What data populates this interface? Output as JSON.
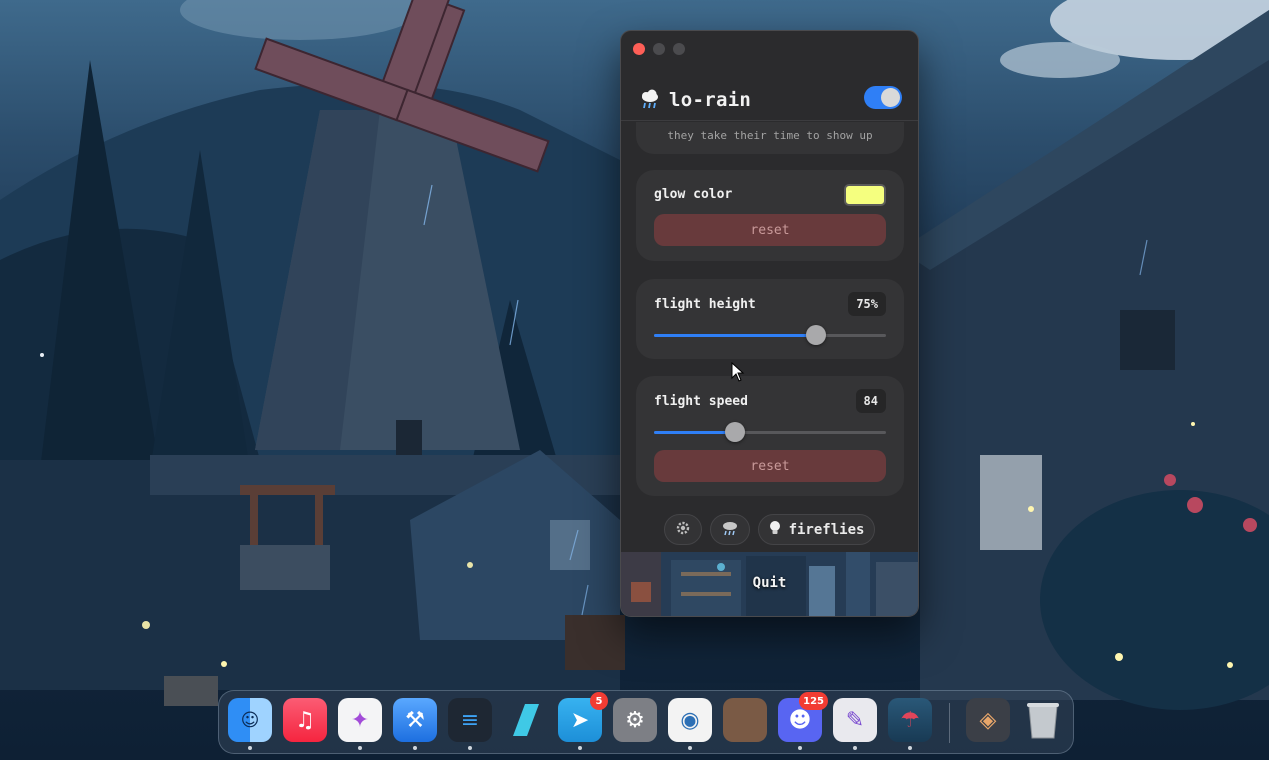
{
  "app": {
    "title": "lo-rain",
    "enabled": true,
    "partial_text": "they take their time to show up"
  },
  "glow_color": {
    "label": "glow color",
    "value": "#f5ff7f",
    "reset_label": "reset"
  },
  "flight_height": {
    "label": "flight height",
    "value_text": "75%",
    "fraction": 0.7
  },
  "flight_speed": {
    "label": "flight speed",
    "value_text": "84",
    "fraction": 0.35,
    "reset_label": "reset"
  },
  "nav": {
    "settings_icon": "gear-icon",
    "rain_icon": "rain-cloud-icon",
    "fireflies_icon": "lightbulb-icon",
    "fireflies_label": "fireflies"
  },
  "footer": {
    "quit_label": "Quit"
  },
  "dock": {
    "items": [
      {
        "name": "finder",
        "icon": "finder-icon"
      },
      {
        "name": "music",
        "icon": "music-icon"
      },
      {
        "name": "app-3",
        "icon": "ai-star-icon"
      },
      {
        "name": "xcode",
        "icon": "xcode-icon"
      },
      {
        "name": "vscode",
        "icon": "vscode-icon"
      },
      {
        "name": "app-6",
        "icon": "app-icon"
      },
      {
        "name": "telegram",
        "icon": "telegram-icon",
        "badge": "5"
      },
      {
        "name": "system-settings",
        "icon": "settings-icon"
      },
      {
        "name": "screenshot",
        "icon": "camera-icon"
      },
      {
        "name": "app-10",
        "icon": "app-icon"
      },
      {
        "name": "discord",
        "icon": "discord-icon",
        "badge": "125"
      },
      {
        "name": "app-12",
        "icon": "paint-icon"
      },
      {
        "name": "lo-rain",
        "icon": "umbrella-icon"
      },
      {
        "name": "app-14",
        "icon": "app-icon"
      },
      {
        "name": "trash",
        "icon": "trash-icon"
      }
    ]
  },
  "colors": {
    "accent": "#2f7ff6",
    "reset_bg": "#683a3c",
    "window_bg": "#2b2b2d"
  }
}
